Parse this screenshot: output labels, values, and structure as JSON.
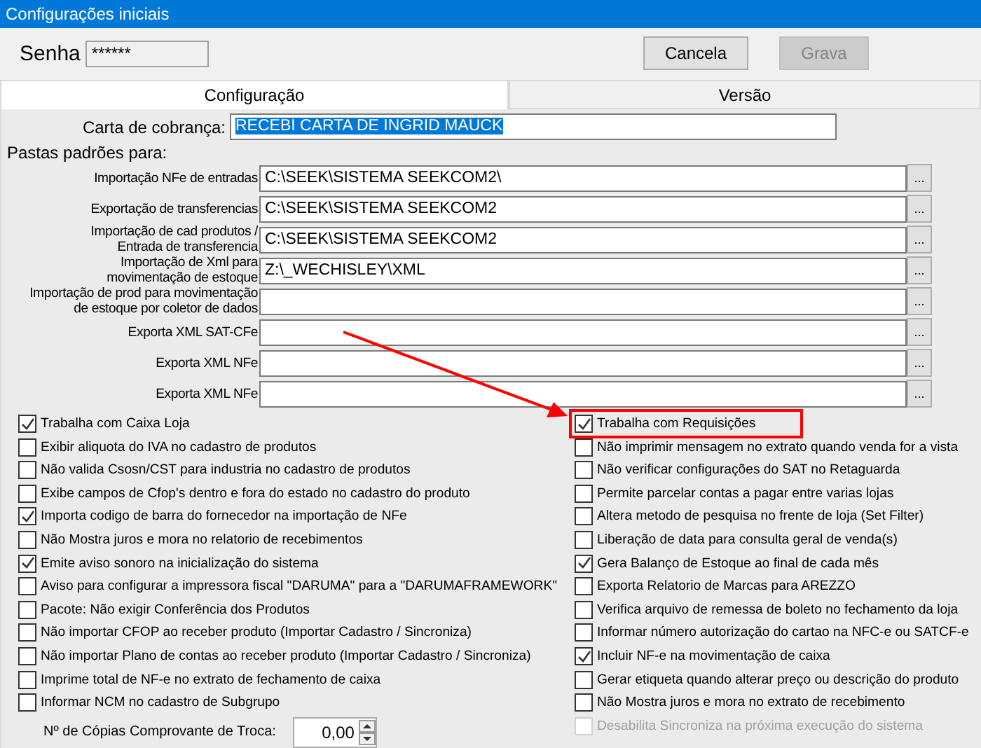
{
  "window": {
    "title": "Configurações iniciais"
  },
  "password": {
    "label": "Senha",
    "value": "******"
  },
  "buttons": [
    {
      "label": "Cancela",
      "disabled": false
    },
    {
      "label": "Grava",
      "disabled": true
    }
  ],
  "tabs": [
    {
      "label": "Configuração",
      "selected": true
    },
    {
      "label": "Versão",
      "selected": false
    }
  ],
  "billing_letter": {
    "label": "Carta de cobrança:",
    "value": "RECEBI CARTA DE INGRID MAUCK",
    "text_selected": true
  },
  "folders": {
    "heading": "Pastas padrões para:",
    "rows": [
      {
        "label_lines": [
          "Importação NFe de entradas"
        ],
        "value": "C:\\SEEK\\SISTEMA SEEKCOM2\\",
        "button": "..."
      },
      {
        "label_lines": [
          "Exportação de transferencias"
        ],
        "value": "C:\\SEEK\\SISTEMA SEEKCOM2",
        "button": "..."
      },
      {
        "label_lines": [
          "Importação de cad produtos /",
          "Entrada de transferencia"
        ],
        "value": "C:\\SEEK\\SISTEMA SEEKCOM2",
        "button": "..."
      },
      {
        "label_lines": [
          "Importação de Xml para",
          "movimentação de estoque"
        ],
        "value": "Z:\\_WECHISLEY\\XML",
        "button": "..."
      },
      {
        "label_lines": [
          "Importação de prod para movimentação",
          "de estoque por coletor de dados"
        ],
        "value": "",
        "button": "..."
      },
      {
        "label_lines": [
          "Exporta XML SAT-CFe"
        ],
        "value": "",
        "button": "..."
      },
      {
        "label_lines": [
          "Exporta XML NFe"
        ],
        "value": "",
        "button": "..."
      },
      {
        "label_lines": [
          "Exporta XML NFe"
        ],
        "value": "",
        "button": "..."
      }
    ]
  },
  "options_left": [
    {
      "label": "Trabalha com Caixa Loja",
      "checked": true
    },
    {
      "label": "Exibir aliquota do IVA no cadastro de produtos",
      "checked": false
    },
    {
      "label": "Não valida Csosn/CST para industria no cadastro de produtos",
      "checked": false
    },
    {
      "label": "Exibe campos de Cfop's dentro e fora do estado no cadastro do produto",
      "checked": false
    },
    {
      "label": "Importa codigo de barra do fornecedor na importação de NFe",
      "checked": true
    },
    {
      "label": "Não Mostra juros e mora no relatorio de recebimentos",
      "checked": false
    },
    {
      "label": "Emite aviso sonoro na inicialização do sistema",
      "checked": true
    },
    {
      "label": "Aviso para configurar a impressora fiscal \"DARUMA\" para a \"DARUMAFRAMEWORK\"",
      "checked": false
    },
    {
      "label": "Pacote: Não exigir Conferência dos Produtos",
      "checked": false
    },
    {
      "label": "Não importar CFOP ao receber produto (Importar Cadastro / Sincroniza)",
      "checked": false
    },
    {
      "label": "Não importar Plano de contas ao receber produto (Importar Cadastro / Sincroniza)",
      "checked": false
    },
    {
      "label": "Imprime total de NF-e no extrato de fechamento de caixa",
      "checked": false
    },
    {
      "label": "Informar NCM no cadastro de Subgrupo",
      "checked": false
    }
  ],
  "options_right": [
    {
      "label": "Trabalha com Requisições",
      "checked": true,
      "disabled": false,
      "highlighted": true
    },
    {
      "label": "Não imprimir mensagem no extrato quando venda for a vista",
      "checked": false,
      "disabled": false,
      "highlighted": false
    },
    {
      "label": "Não verificar configurações do SAT no Retaguarda",
      "checked": false,
      "disabled": false,
      "highlighted": false
    },
    {
      "label": "Permite parcelar contas a pagar entre varias lojas",
      "checked": false,
      "disabled": false,
      "highlighted": false
    },
    {
      "label": "Altera metodo de pesquisa no frente de loja (Set Filter)",
      "checked": false,
      "disabled": false,
      "highlighted": false
    },
    {
      "label": "Liberação de data para consulta geral de venda(s)",
      "checked": false,
      "disabled": false,
      "highlighted": false
    },
    {
      "label": "Gera Balanço de Estoque ao final de cada mês",
      "checked": true,
      "disabled": false,
      "highlighted": false
    },
    {
      "label": "Exporta Relatorio de Marcas para AREZZO",
      "checked": false,
      "disabled": false,
      "highlighted": false
    },
    {
      "label": "Verifica arquivo de remessa de boleto no fechamento da loja",
      "checked": false,
      "disabled": false,
      "highlighted": false
    },
    {
      "label": "Informar número autorização do cartao na NFC-e ou SATCF-e",
      "checked": false,
      "disabled": false,
      "highlighted": false
    },
    {
      "label": "Incluir NF-e na movimentação de caixa",
      "checked": true,
      "disabled": false,
      "highlighted": false
    },
    {
      "label": "Gerar etiqueta quando alterar preço ou descrição do produto",
      "checked": false,
      "disabled": false,
      "highlighted": false
    },
    {
      "label": "Não Mostra juros e mora no extrato de recebimento",
      "checked": false,
      "disabled": false,
      "highlighted": false
    },
    {
      "label": "Desabilita Sincroniza na próxima execução do sistema",
      "checked": false,
      "disabled": true,
      "highlighted": false
    }
  ],
  "copies": {
    "label": "Nº de Cópias Comprovante de Troca:",
    "value": "0,00"
  },
  "annotation": {
    "kind": "arrow"
  }
}
